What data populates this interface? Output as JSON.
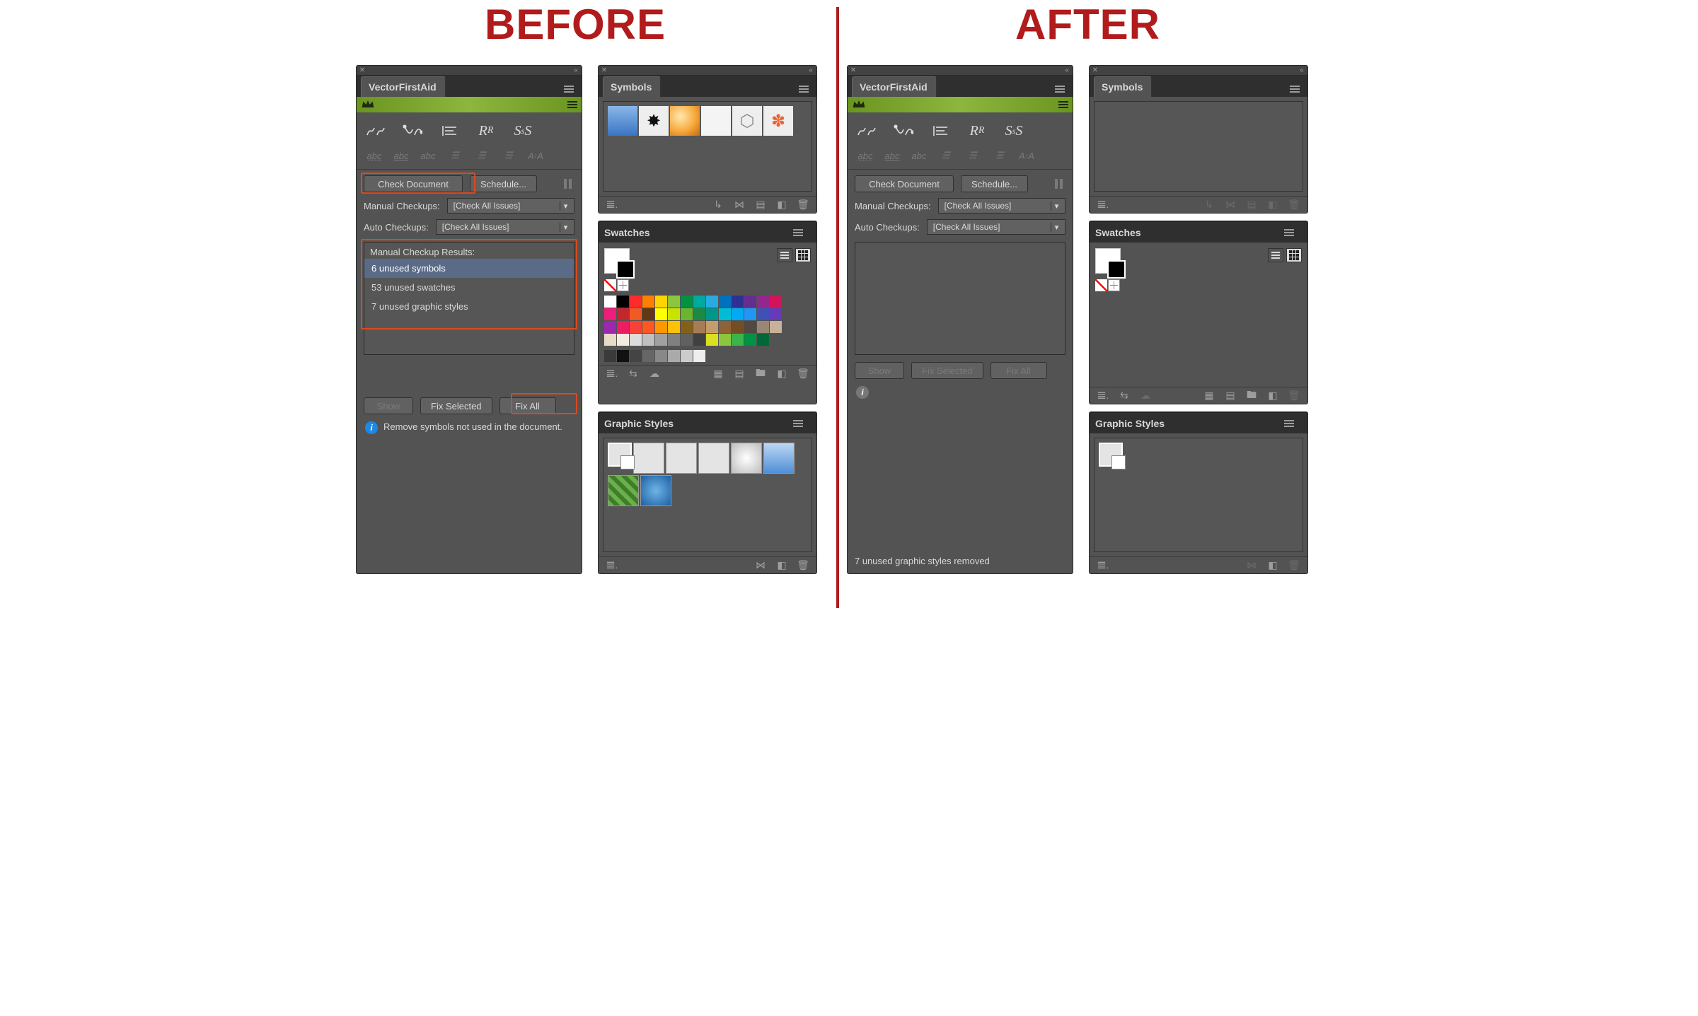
{
  "titles": {
    "before": "BEFORE",
    "after": "AFTER"
  },
  "vfa": {
    "tab": "VectorFirstAid",
    "check_btn": "Check Document",
    "schedule_btn": "Schedule...",
    "manual_label": "Manual Checkups:",
    "auto_label": "Auto Checkups:",
    "dropdown_value": "[Check All Issues]",
    "results_title": "Manual Checkup Results:",
    "show_btn": "Show",
    "fix_selected_btn": "Fix Selected",
    "fix_all_btn": "Fix All",
    "before": {
      "results": [
        "6 unused symbols",
        "53 unused swatches",
        "7 unused graphic styles"
      ],
      "info": "Remove symbols not used in the document."
    },
    "after": {
      "status": "7 unused graphic styles removed"
    }
  },
  "panels": {
    "symbols": "Symbols",
    "swatches": "Swatches",
    "graphic_styles": "Graphic Styles"
  },
  "footer_icons": {
    "library": "library-icon",
    "break": "break-link-icon",
    "link": "link-off-icon",
    "instance": "instance-icon",
    "new": "new-icon",
    "trash": "trash-icon",
    "swap": "swap-icon",
    "cloud": "cloud-icon",
    "grid": "grid-icon",
    "list": "list-icon",
    "folder": "folder-icon"
  },
  "swatches_before": [
    "#ffffff",
    "#000000",
    "#ff2a2a",
    "#ff7f00",
    "#ffd400",
    "#8cc63f",
    "#009245",
    "#00a99d",
    "#29abe2",
    "#0071bc",
    "#2e3192",
    "#662d91",
    "#93278f",
    "#d4145a",
    "#ed1e79",
    "#c1272d",
    "#f15a24",
    "#603813",
    "#ffff00",
    "#c8e300",
    "#6ab52e",
    "#1b8a44",
    "#009688",
    "#00bcd4",
    "#03a9f4",
    "#2196f3",
    "#3f51b5",
    "#673ab7",
    "#9c27b0",
    "#e91e63",
    "#f44336",
    "#ff5722",
    "#ff9800",
    "#ffc107",
    "#84611b",
    "#a67c52",
    "#c69c6d",
    "#8c6239",
    "#754c24",
    "#534741",
    "#998675",
    "#c7b299",
    "#e6ddc4",
    "#f2ece0",
    "#dcdcdc",
    "#c0c0c0",
    "#a0a0a0",
    "#808080",
    "#606060",
    "#404040",
    "#d9e021",
    "#8cc63f",
    "#39b54a",
    "#009245",
    "#006837"
  ]
}
